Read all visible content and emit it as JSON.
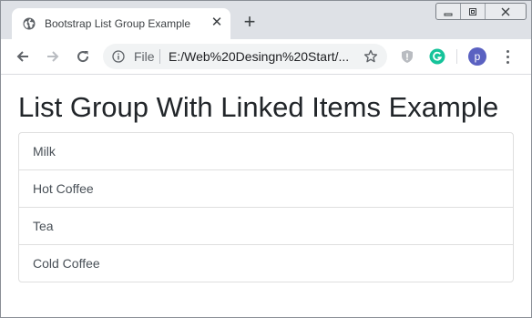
{
  "browser": {
    "tab": {
      "title": "Bootstrap List Group Example",
      "favicon": "globe-icon"
    },
    "toolbar": {
      "address": {
        "scheme": "File",
        "url": "E:/Web%20Desingn%20Start/..."
      },
      "profile_initial": "p"
    }
  },
  "page": {
    "heading": "List Group With Linked Items Example",
    "list_items": [
      {
        "label": "Milk"
      },
      {
        "label": "Hot Coffee"
      },
      {
        "label": "Tea"
      },
      {
        "label": "Cold Coffee"
      }
    ]
  },
  "colors": {
    "tab_strip": "#dee1e6",
    "omnibox": "#f1f3f4",
    "avatar": "#5a61c1",
    "grammarly": "#15c39a",
    "list_text": "#495057",
    "list_border": "#dfdfdf"
  }
}
